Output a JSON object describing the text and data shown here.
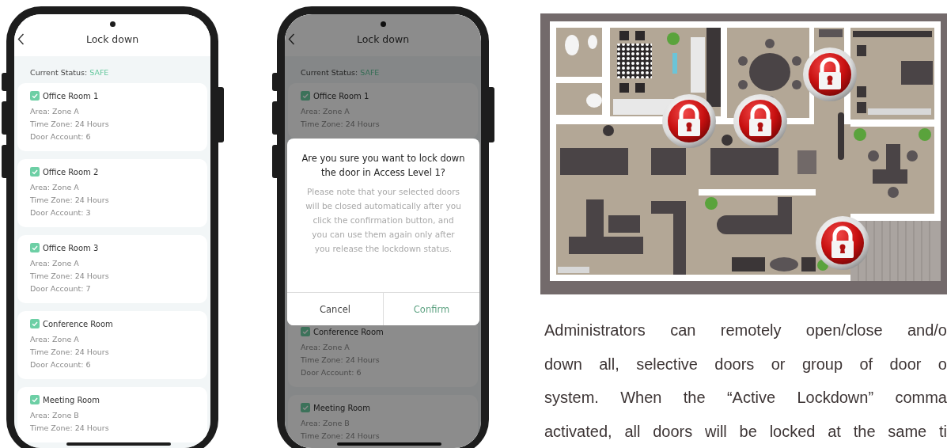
{
  "screens": [
    {
      "header": {
        "title": "Lock down"
      },
      "status": {
        "label": "Current Status:",
        "value": "SAFE"
      },
      "rooms": [
        {
          "name": "Office Room 1",
          "checked": true,
          "details": [
            "Area: Zone A",
            "Time Zone: 24 Hours",
            "Door Account: 6"
          ]
        },
        {
          "name": "Office Room 2",
          "checked": true,
          "details": [
            "Area: Zone A",
            "Time Zone: 24 Hours",
            "Door Account: 3"
          ]
        },
        {
          "name": "Office Room 3",
          "checked": true,
          "details": [
            "Area: Zone A",
            "Time Zone: 24 Hours",
            "Door Account: 7"
          ]
        },
        {
          "name": "Conference Room",
          "checked": true,
          "details": [
            "Area: Zone A",
            "Time Zone: 24 Hours",
            "Door Account: 6"
          ]
        },
        {
          "name": "Meeting Room",
          "checked": true,
          "details": [
            "Area: Zone B",
            "Time Zone: 24 Hours"
          ]
        }
      ]
    },
    {
      "header": {
        "title": "Lock down"
      },
      "status": {
        "label": "Current Status:",
        "value": "SAFE"
      },
      "rooms": [
        {
          "name": "Office Room 1",
          "checked": true,
          "details": [
            "Area: Zone A",
            "Time Zone: 24 Hours"
          ]
        },
        {
          "name": "Conference Room",
          "checked": true,
          "details": [
            "Area: Zone A",
            "Time Zone: 24 Hours",
            "Door Account: 6"
          ]
        },
        {
          "name": "Meeting Room",
          "checked": true,
          "details": [
            "Area: Zone B",
            "Time Zone: 24 Hours"
          ]
        }
      ],
      "dialog": {
        "title": "Are you sure you want to lock down the door in Access Level 1?",
        "message": "Please note that your selected doors will be closed automatically after you click the confirmation button, and you can use them again only after you release the lockdown status.",
        "buttons": [
          {
            "label": "Cancel",
            "kind": "cancel"
          },
          {
            "label": "Confirm",
            "kind": "confirm"
          }
        ]
      }
    }
  ],
  "description": {
    "lines": [
      "Administrators can remotely open/close and/o",
      "down all, selective doors or group of door o",
      "system. When the “Active Lockdown” comma",
      "activated, all doors will be locked at the same ti"
    ]
  }
}
